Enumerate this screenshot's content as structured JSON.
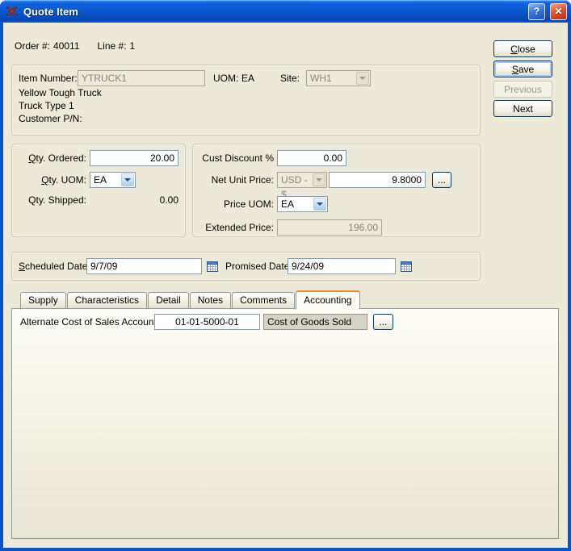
{
  "window": {
    "title": "Quote Item",
    "help_glyph": "?",
    "close_glyph": "✕"
  },
  "header": {
    "order_label": "Order #:",
    "order_value": "40011",
    "line_label": "Line #:",
    "line_value": "1"
  },
  "actions": {
    "close": "Close",
    "save": "Save",
    "previous": "Previous",
    "next": "Next"
  },
  "item": {
    "item_number_label": "Item Number:",
    "item_number_value": "YTRUCK1",
    "uom_label": "UOM:",
    "uom_value": "EA",
    "site_label": "Site:",
    "site_value": "WH1",
    "description_line1": "Yellow Tough Truck",
    "description_line2": "Truck Type 1",
    "customer_pn_label": "Customer P/N:"
  },
  "quantity": {
    "qty_ordered_label": "Qty. Ordered:",
    "qty_ordered_value": "20.00",
    "qty_uom_label": "Qty. UOM:",
    "qty_uom_value": "EA",
    "qty_shipped_label": "Qty. Shipped:",
    "qty_shipped_value": "0.00"
  },
  "pricing": {
    "cust_discount_label": "Cust Discount %",
    "cust_discount_value": "0.00",
    "net_unit_price_label": "Net Unit Price:",
    "currency_value": "USD - $",
    "net_unit_price_value": "9.8000",
    "price_list_label": "...",
    "price_uom_label": "Price UOM:",
    "price_uom_value": "EA",
    "extended_price_label": "Extended Price:",
    "extended_price_value": "196.00"
  },
  "dates": {
    "scheduled_label": "Scheduled Date:",
    "scheduled_value": "9/7/09",
    "promised_label": "Promised Date:",
    "promised_value": "9/24/09"
  },
  "tabs": [
    {
      "label": "Supply",
      "active": false
    },
    {
      "label": "Characteristics",
      "active": false
    },
    {
      "label": "Detail",
      "active": false
    },
    {
      "label": "Notes",
      "active": false
    },
    {
      "label": "Comments",
      "active": false
    },
    {
      "label": "Accounting",
      "active": true
    }
  ],
  "accounting_tab": {
    "alt_cos_label": "Alternate Cost of Sales Account",
    "account_number": "01-01-5000-01",
    "account_description": "Cost of Goods Sold",
    "lookup_label": "..."
  },
  "icons": {
    "app": "red-x-logo",
    "calendar": "calendar-grid",
    "combo_arrow": "chevron-down"
  },
  "colors": {
    "titlebar_blue": "#0A58D0",
    "window_bg": "#ECE9D8",
    "tab_accent_orange": "#E68B2C",
    "close_button_red": "#D6492A",
    "input_border": "#7F9DB9",
    "default_button_glow": "#A9C9F1",
    "disabled_field_bg": "#EDEADB",
    "readonly_gray_bg": "#D7D3C6"
  }
}
